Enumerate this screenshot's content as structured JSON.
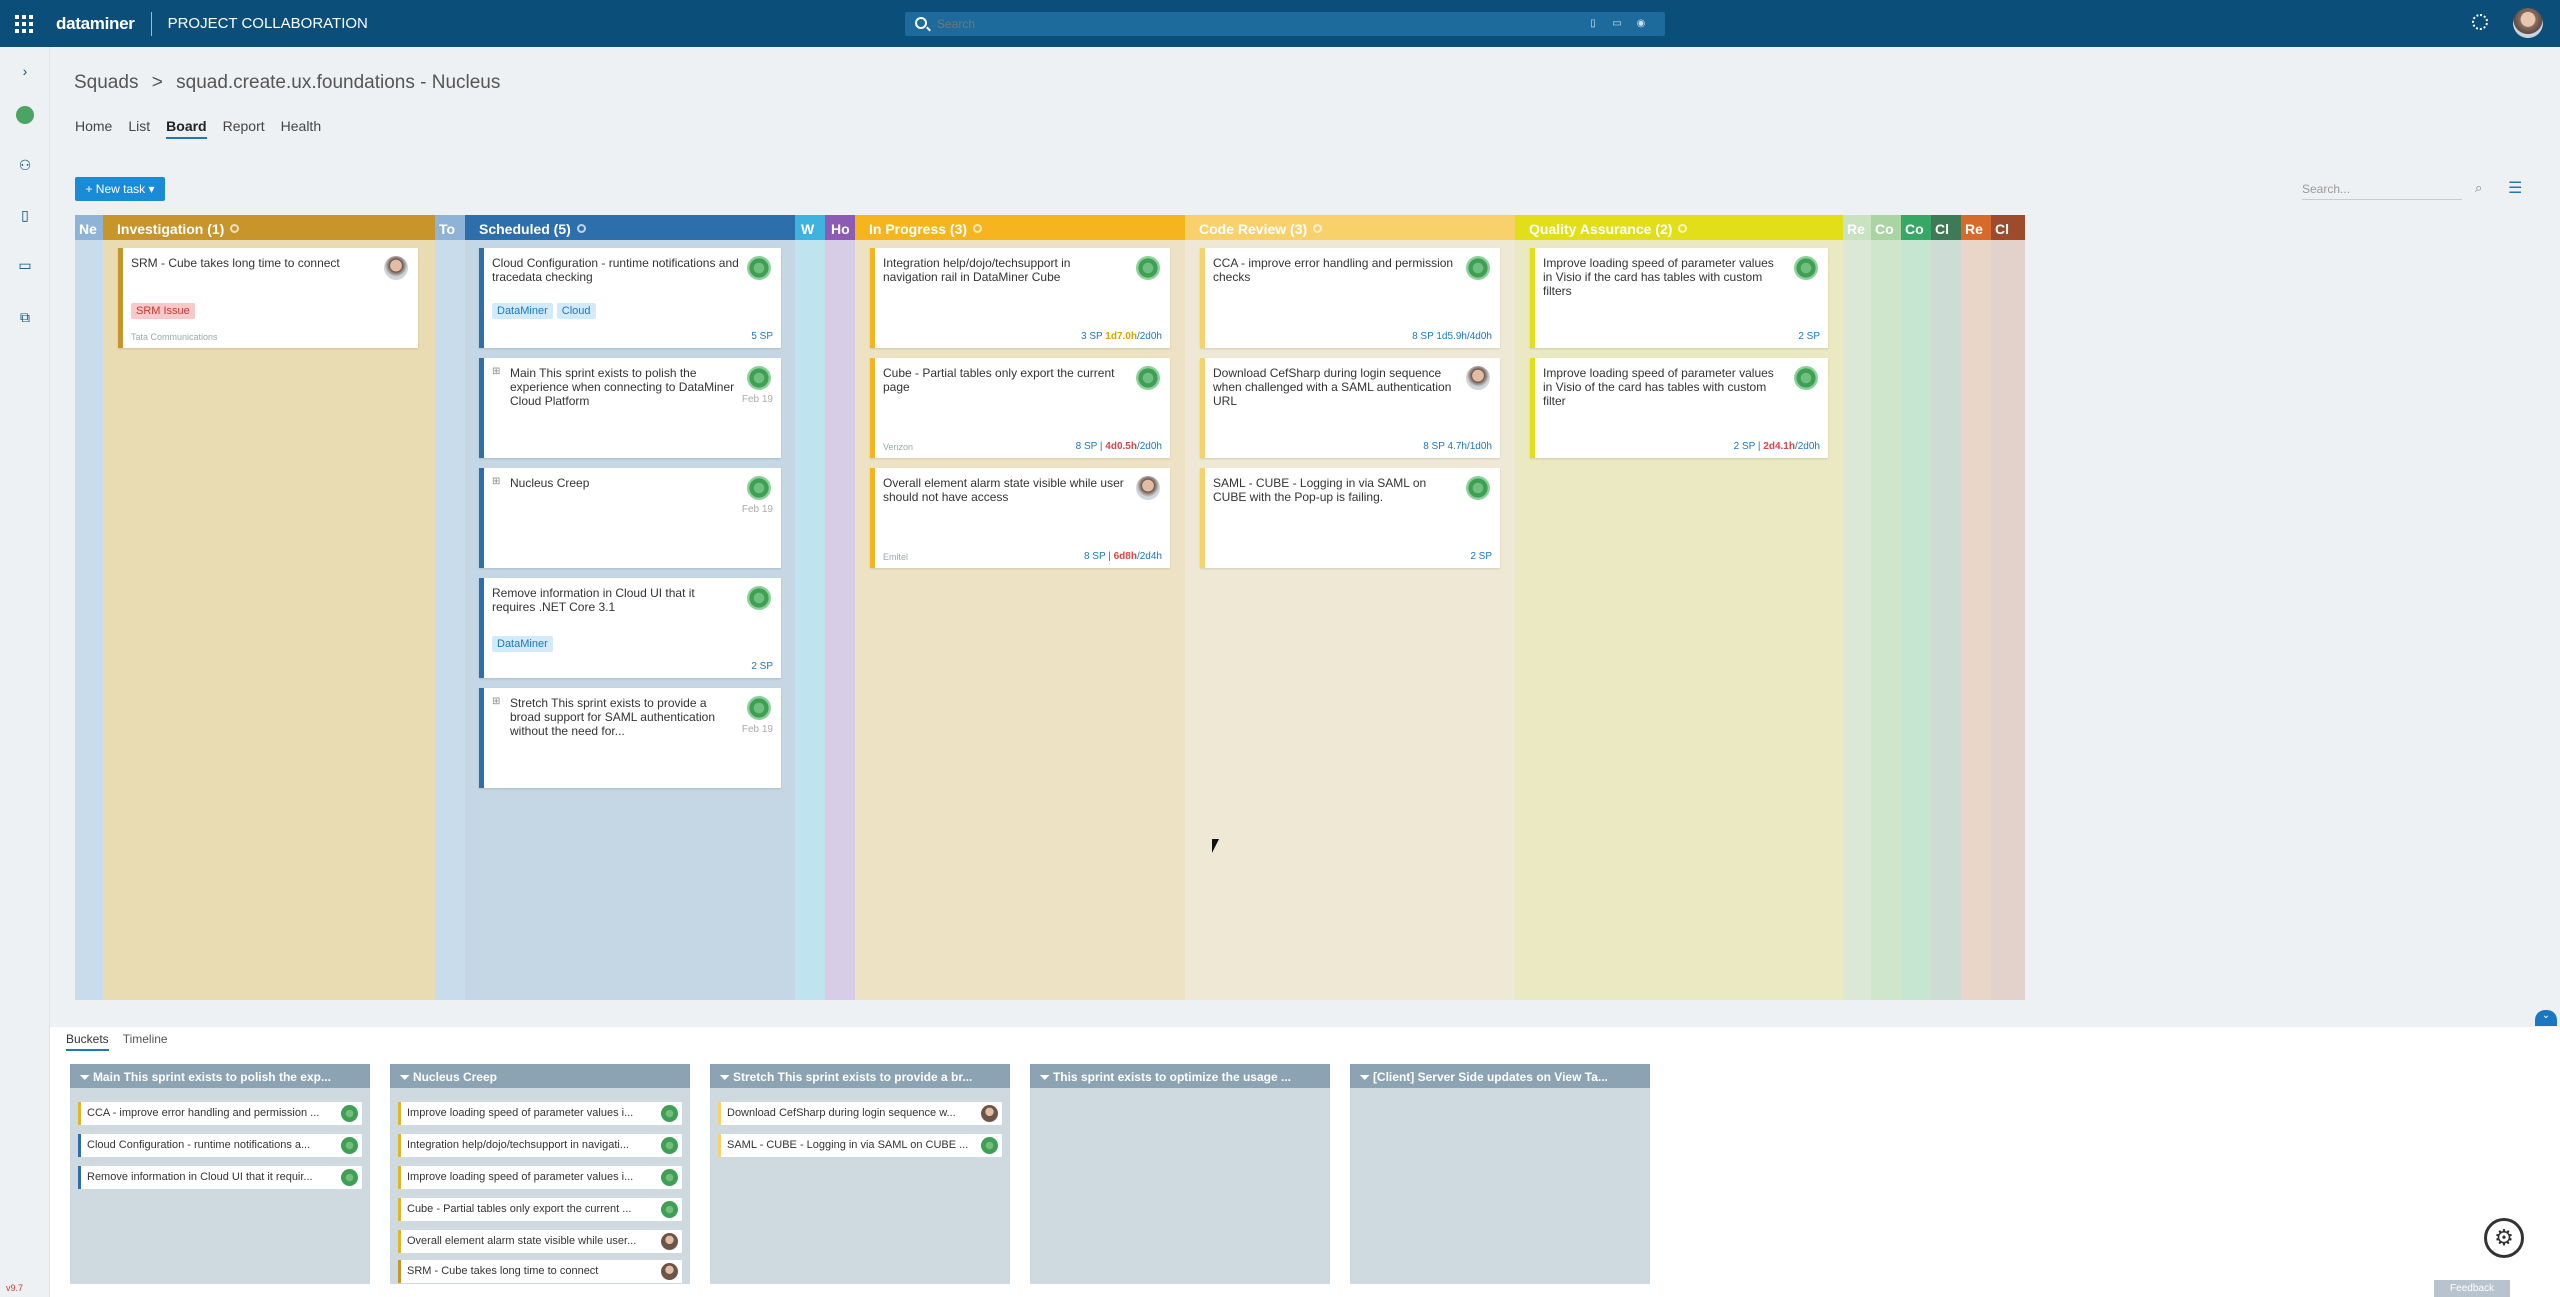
{
  "app": {
    "brand": "dataminer",
    "title": "PROJECT COLLABORATION",
    "search_placeholder": "Search"
  },
  "breadcrumb": {
    "root": "Squads",
    "sep": ">",
    "current": "squad.create.ux.foundations - Nucleus"
  },
  "tabs": [
    {
      "label": "Home"
    },
    {
      "label": "List"
    },
    {
      "label": "Board"
    },
    {
      "label": "Report"
    },
    {
      "label": "Health"
    }
  ],
  "toolbar": {
    "new_task": "+ New task ▾",
    "search_placeholder": "Search..."
  },
  "columns": [
    {
      "label": "Investigation (1)",
      "color": "#c7952a"
    },
    {
      "label": "Scheduled (5)",
      "color": "#2d6fad"
    },
    {
      "label": "In Progress (3)",
      "color": "#f6b51f"
    },
    {
      "label": "Code Review (3)",
      "color": "#f8d16b"
    },
    {
      "label": "Quality Assurance (2)",
      "color": "#e2df18"
    }
  ],
  "collapsed": [
    "Ne",
    "To",
    "W",
    "Ho",
    "Re",
    "Co",
    "Co",
    "Cl",
    "Re",
    "Cl"
  ],
  "cards": {
    "inv1": {
      "title": "SRM - Cube takes long time to connect",
      "tag": "SRM Issue",
      "client": "Tata Communications"
    },
    "sch1": {
      "title": "Cloud Configuration - runtime notifications and tracedata checking",
      "tag1": "DataMiner",
      "tag2": "Cloud",
      "sp": "5 SP"
    },
    "sch2": {
      "title": "Main This sprint exists to polish the experience when connecting to DataMiner Cloud Platform",
      "date": "Feb 19"
    },
    "sch3": {
      "title": "Nucleus Creep",
      "date": "Feb 19"
    },
    "sch4": {
      "title": "Remove information in Cloud UI that it requires .NET Core 3.1",
      "tag": "DataMiner",
      "sp": "2 SP"
    },
    "sch5": {
      "title": "Stretch This sprint exists to provide a broad support for SAML authentication without the need for...",
      "date": "Feb 19"
    },
    "ip1": {
      "title": "Integration help/dojo/techsupport in navigation rail in DataMiner Cube",
      "sp": "3 SP",
      "time1": "1d7.0h",
      "time2": "/2d0h"
    },
    "ip2": {
      "title": "Cube - Partial tables only export the current page",
      "client": "Verizon",
      "sp": "8 SP",
      "time1": "4d0.5h",
      "time2": "/2d0h"
    },
    "ip3": {
      "title": "Overall element alarm state visible while user should not have access",
      "client": "Emitel",
      "sp": "8 SP",
      "time1": "6d8h",
      "time2": "/2d4h"
    },
    "cr1": {
      "title": "CCA - improve error handling and permission checks",
      "sp": "8 SP",
      "time": "1d5.9h/4d0h"
    },
    "cr2": {
      "title": "Download CefSharp during login sequence when challenged with a SAML authentication URL",
      "sp": "8 SP",
      "time": "4.7h/1d0h"
    },
    "cr3": {
      "title": "SAML - CUBE - Logging in via SAML on CUBE with the Pop-up is failing.",
      "sp": "2 SP"
    },
    "qa1": {
      "title": "Improve loading speed of parameter values in Visio if the card has tables with custom filters",
      "sp": "2 SP"
    },
    "qa2": {
      "title": "Improve loading speed of parameter values in Visio of the card has tables with custom filter",
      "sp": "2 SP",
      "time1": "2d4.1h",
      "time2": "/2d0h"
    }
  },
  "lower_tabs": [
    {
      "label": "Buckets"
    },
    {
      "label": "Timeline"
    }
  ],
  "buckets": [
    {
      "title": "Main This sprint exists to polish the exp...",
      "items": [
        "CCA - improve error handling and permission ...",
        "Cloud Configuration - runtime notifications a...",
        "Remove information in Cloud UI that it requir..."
      ]
    },
    {
      "title": "Nucleus Creep",
      "items": [
        "Improve loading speed of parameter values i...",
        "Integration help/dojo/techsupport in navigati...",
        "Improve loading speed of parameter values i...",
        "Cube - Partial tables only export the current ...",
        "Overall element alarm state visible while user...",
        "SRM - Cube takes long time to connect"
      ]
    },
    {
      "title": "Stretch This sprint exists to provide a br...",
      "items": [
        "Download CefSharp during login sequence w...",
        "SAML - CUBE - Logging in via SAML on CUBE ..."
      ]
    },
    {
      "title": "This sprint exists to optimize the usage ...",
      "items": []
    },
    {
      "title": "[Client] Server Side updates on View Ta...",
      "items": []
    }
  ],
  "footer": {
    "feedback": "Feedback",
    "version": "v9.7"
  }
}
